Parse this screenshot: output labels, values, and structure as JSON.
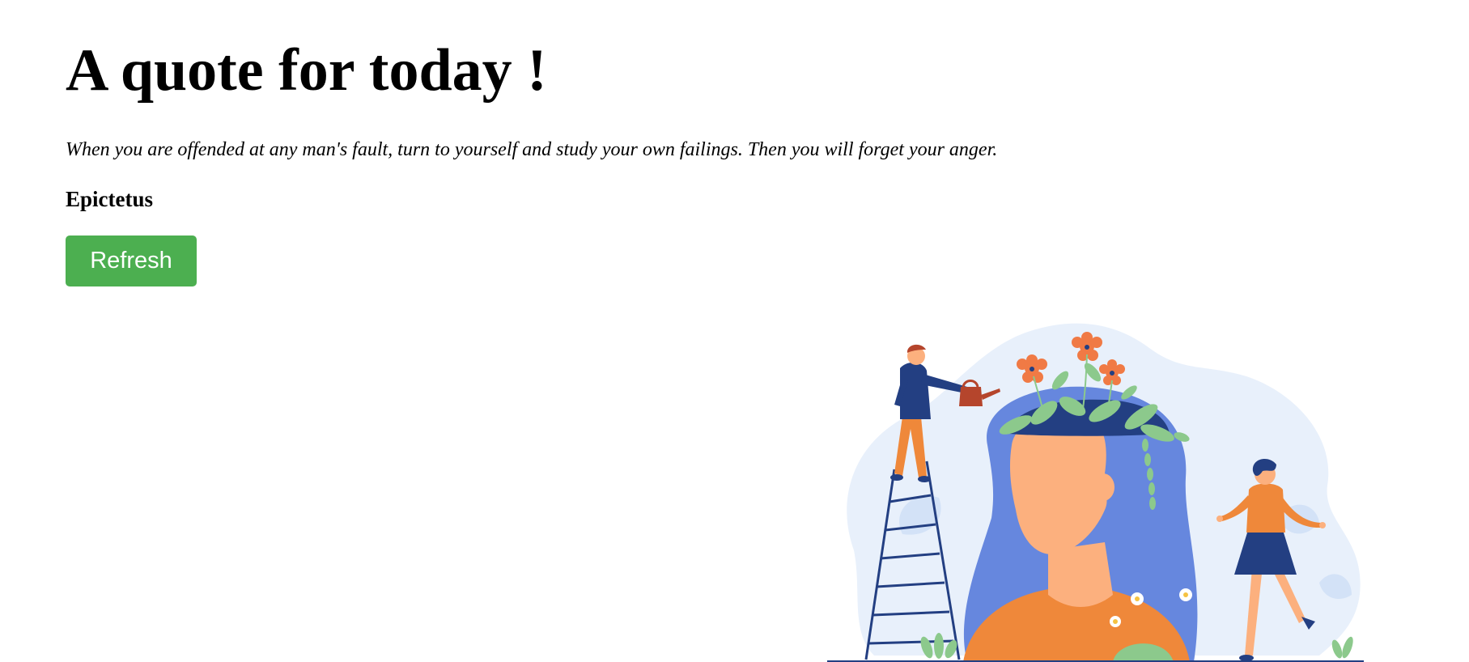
{
  "page": {
    "title": "A quote for today !"
  },
  "quote": {
    "text": "When you are offended at any man's fault, turn to yourself and study your own failings. Then you will forget your anger.",
    "author": "Epictetus"
  },
  "actions": {
    "refresh_label": "Refresh"
  },
  "colors": {
    "button_bg": "#4CAF50",
    "button_text": "#ffffff",
    "blob": "#E8F0FB",
    "hair": "#6687DE",
    "skin": "#FCB07E",
    "shirt_orange": "#EF883A",
    "navy": "#233F82",
    "leaf": "#8CC98C",
    "flower": "#F07A45"
  },
  "illustration": {
    "icon": "head-garden-illustration"
  }
}
